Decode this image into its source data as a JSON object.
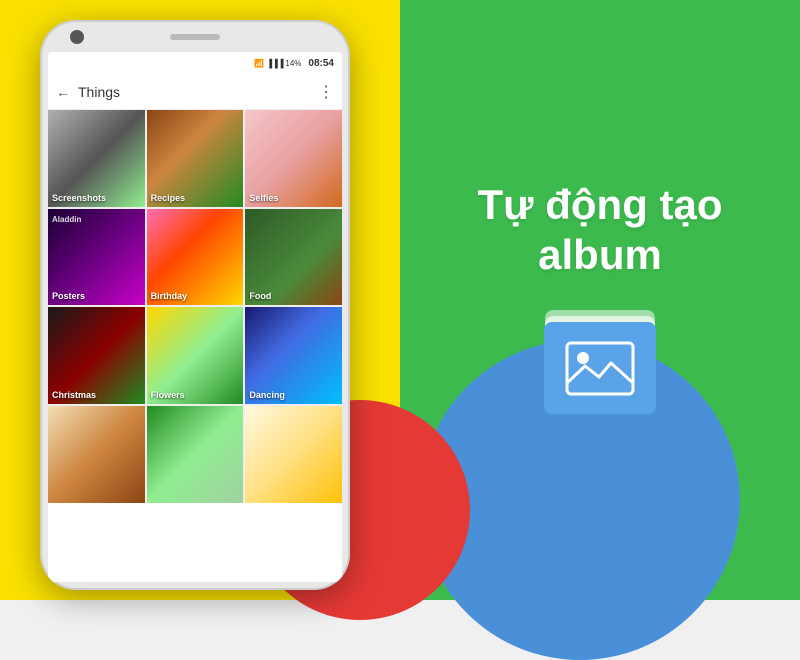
{
  "background": {
    "yellow": "#f9e000",
    "green": "#3dba4e",
    "blue": "#4a90d9",
    "red": "#e53935"
  },
  "phone": {
    "status": {
      "battery": "14%",
      "time": "08:54"
    },
    "header": {
      "title": "Things",
      "back_label": "←",
      "menu_label": "⋮"
    },
    "grid": [
      {
        "id": "screenshots",
        "label": "Screenshots",
        "thumb_class": "thumb-screenshots"
      },
      {
        "id": "recipes",
        "label": "Recipes",
        "thumb_class": "thumb-recipes"
      },
      {
        "id": "selfies",
        "label": "Selfies",
        "thumb_class": "thumb-selfies"
      },
      {
        "id": "posters",
        "label": "Posters",
        "thumb_class": "thumb-posters"
      },
      {
        "id": "birthday",
        "label": "Birthday",
        "thumb_class": "thumb-birthday"
      },
      {
        "id": "food",
        "label": "Food",
        "thumb_class": "thumb-food"
      },
      {
        "id": "christmas",
        "label": "Christmas",
        "thumb_class": "thumb-christmas"
      },
      {
        "id": "flowers",
        "label": "Flowers",
        "thumb_class": "thumb-flowers"
      },
      {
        "id": "dancing",
        "label": "Dancing",
        "thumb_class": "thumb-dancing"
      },
      {
        "id": "row4a",
        "label": "",
        "thumb_class": "thumb-row4a"
      },
      {
        "id": "row4b",
        "label": "",
        "thumb_class": "thumb-row4b"
      },
      {
        "id": "row4c",
        "label": "",
        "thumb_class": "thumb-row4c"
      }
    ]
  },
  "promo": {
    "line1": "Tự động tạo",
    "line2": "album"
  }
}
